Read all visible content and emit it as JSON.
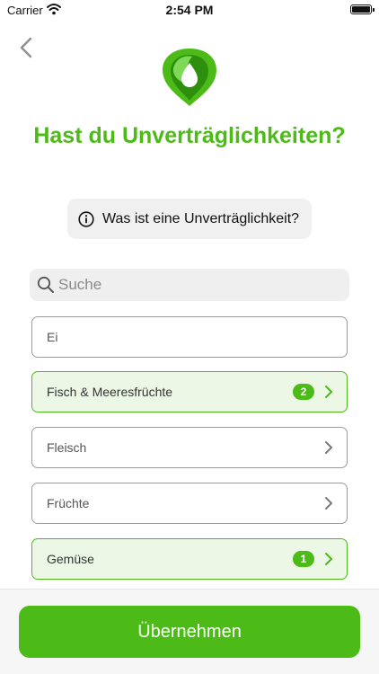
{
  "status_bar": {
    "carrier": "Carrier",
    "time": "2:54 PM"
  },
  "header": {
    "title": "Hast du Unverträglichkeiten?"
  },
  "info": {
    "label": "Was ist eine Unverträglichkeit?"
  },
  "search": {
    "placeholder": "Suche"
  },
  "categories": [
    {
      "label": "Ei",
      "selected": false,
      "count": "",
      "has_chevron": false
    },
    {
      "label": "Fisch & Meeresfrüchte",
      "selected": true,
      "count": "2",
      "has_chevron": true
    },
    {
      "label": "Fleisch",
      "selected": false,
      "count": "",
      "has_chevron": true
    },
    {
      "label": "Früchte",
      "selected": false,
      "count": "",
      "has_chevron": true
    },
    {
      "label": "Gemüse",
      "selected": true,
      "count": "1",
      "has_chevron": true
    }
  ],
  "footer": {
    "apply_label": "Übernehmen"
  },
  "colors": {
    "accent": "#4cbb17",
    "selected_background": "#ecf8e5",
    "border_gray": "#9b9b9b"
  },
  "icons": {
    "back": "chevron-left-icon",
    "logo": "leaf-drop-logo",
    "info": "info-circle-icon",
    "search": "magnifier-icon",
    "row": "chevron-right-icon"
  }
}
